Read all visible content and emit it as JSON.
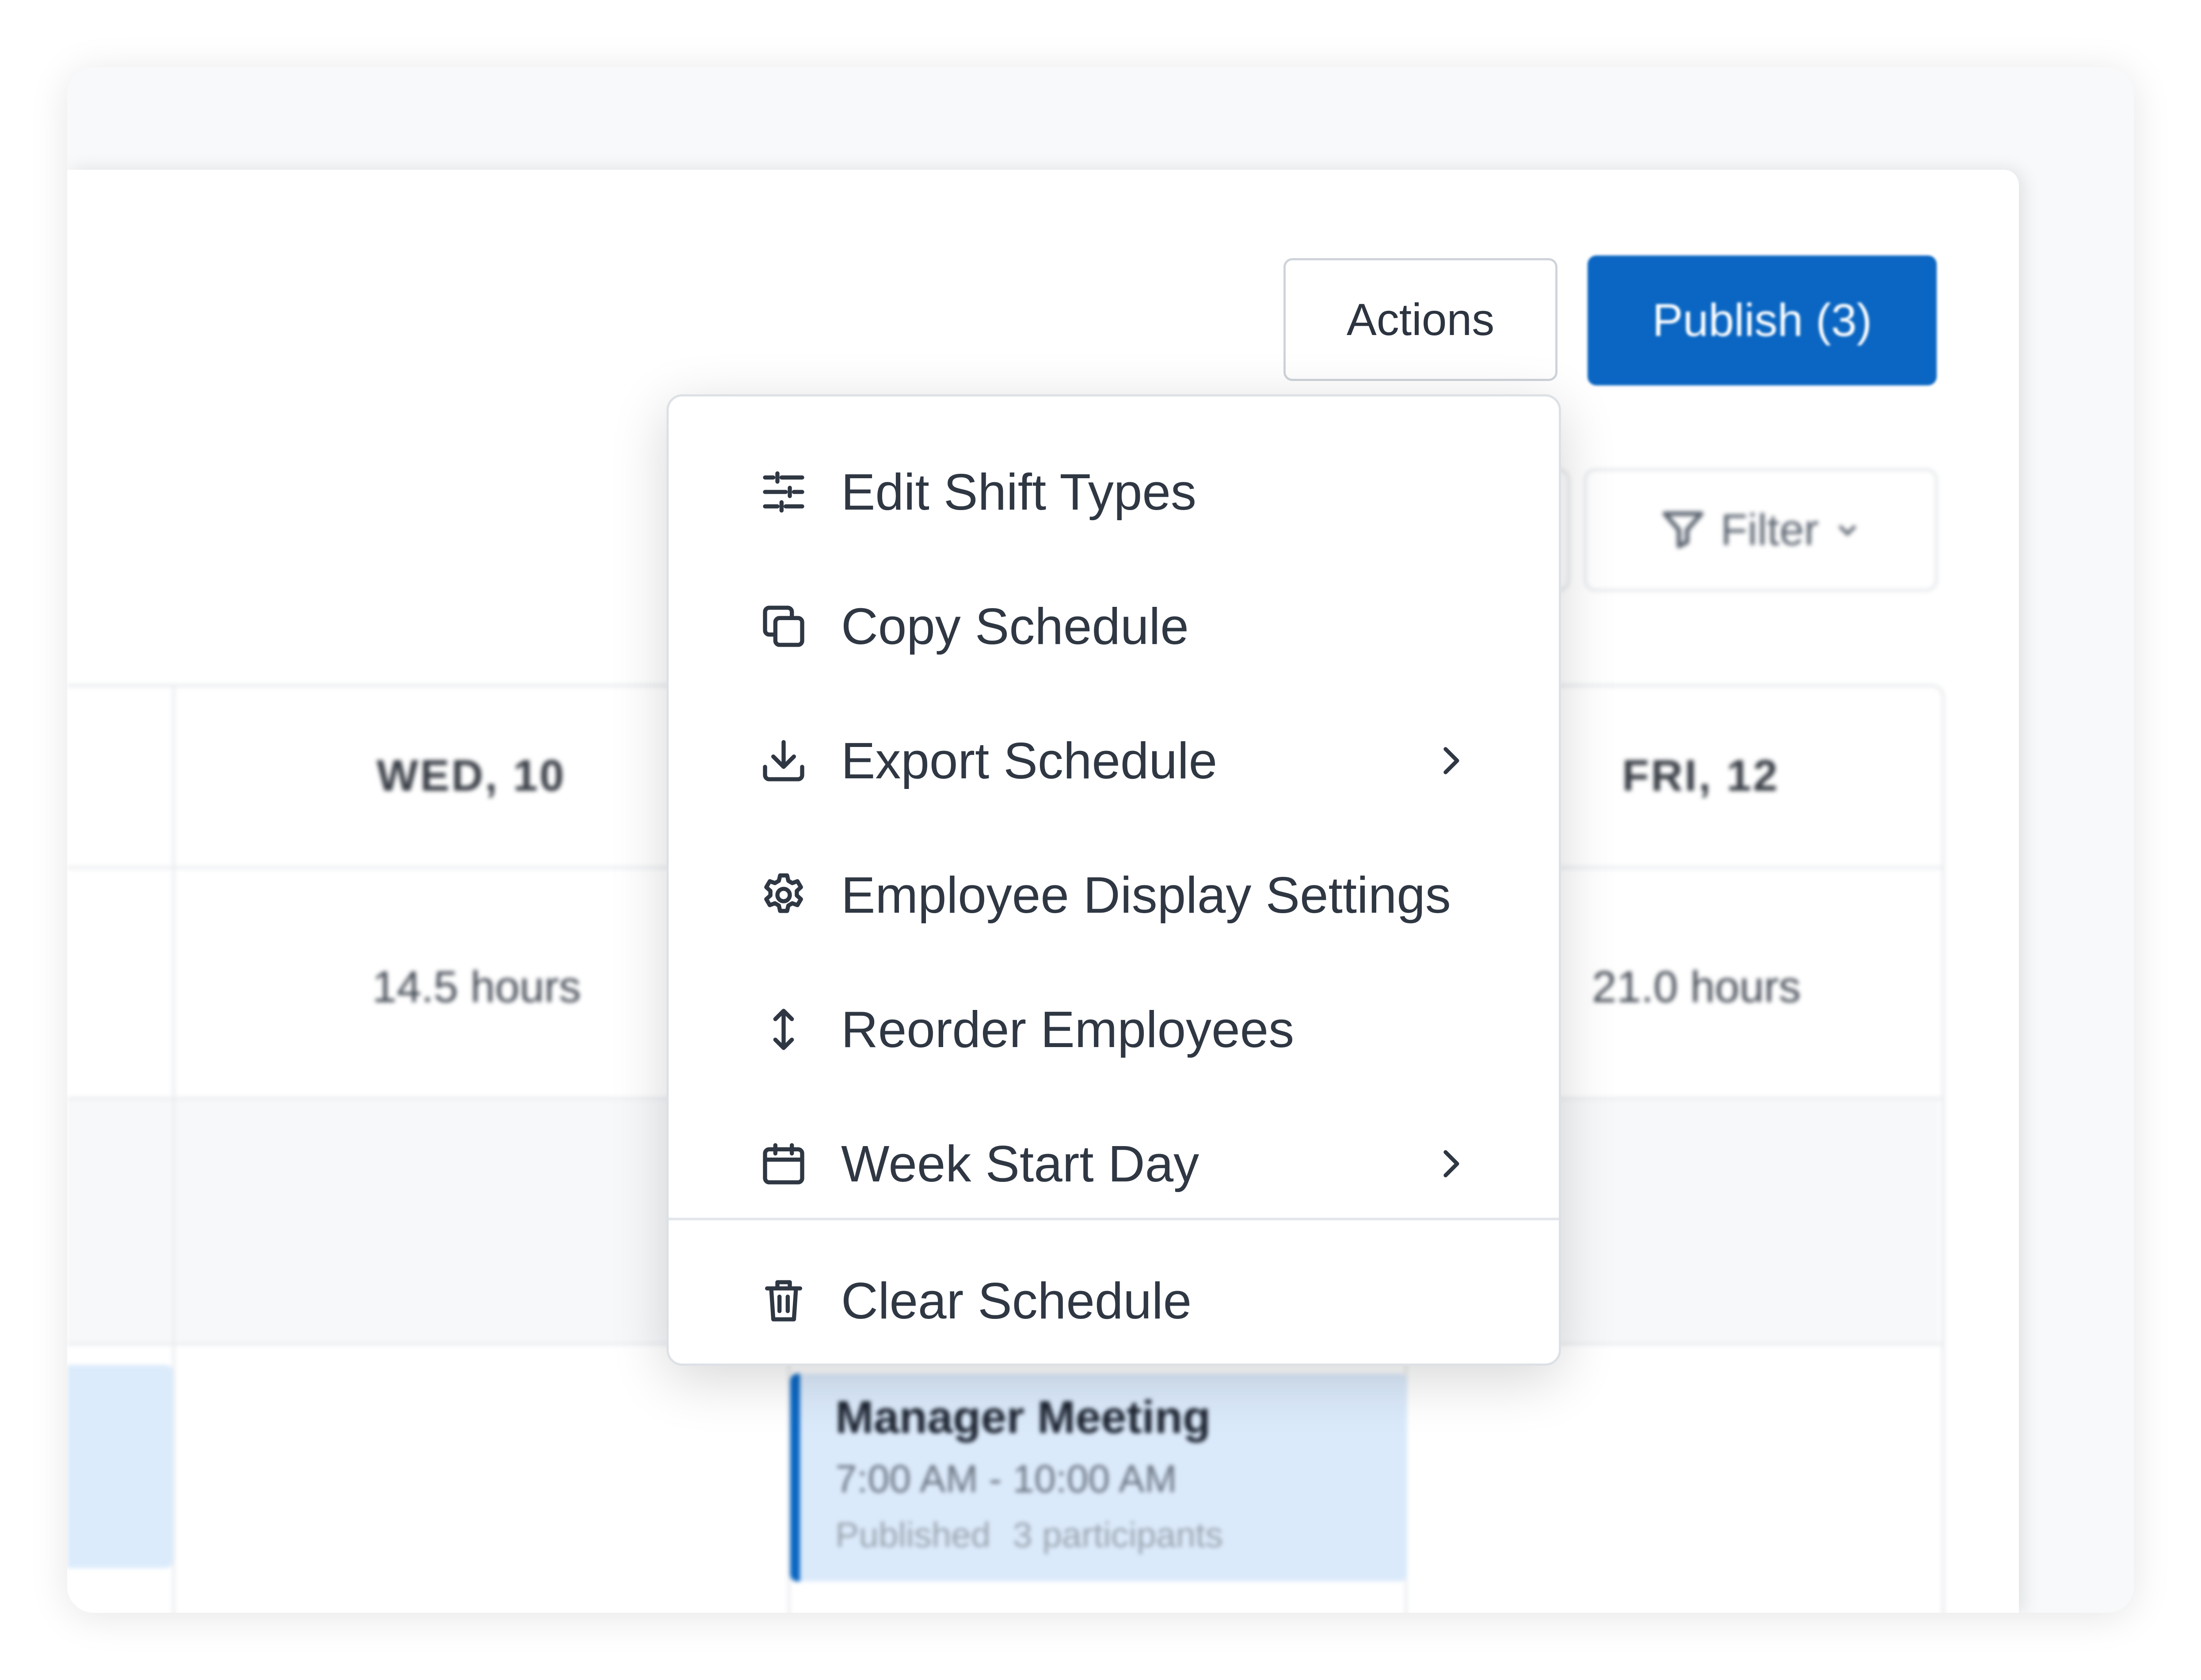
{
  "header": {
    "actions_label": "Actions",
    "publish_label": "Publish (3)",
    "filter_label": "Filter"
  },
  "grid": {
    "days": [
      {
        "label": "WED, 10",
        "hours": "14.5 hours"
      },
      {
        "label": "FRI, 12",
        "hours": "21.0 hours"
      }
    ],
    "shift": {
      "title": "Manager Meeting",
      "time": "7:00 AM - 10:00 AM",
      "status": "Published",
      "participants": "3 participants"
    }
  },
  "menu": {
    "items": [
      {
        "label": "Edit Shift Types",
        "icon": "sliders-icon",
        "submenu": false
      },
      {
        "label": "Copy Schedule",
        "icon": "copy-icon",
        "submenu": false
      },
      {
        "label": "Export Schedule",
        "icon": "download-icon",
        "submenu": true
      },
      {
        "label": "Employee Display Settings",
        "icon": "gear-icon",
        "submenu": false
      },
      {
        "label": "Reorder Employees",
        "icon": "vertical-arrows-icon",
        "submenu": false
      },
      {
        "label": "Week Start Day",
        "icon": "calendar-icon",
        "submenu": true
      },
      {
        "label": "Clear Schedule",
        "icon": "trash-icon",
        "submenu": false
      }
    ]
  },
  "colors": {
    "primary": "#0a66c2",
    "text": "#2f3743",
    "shift_bg": "#dbeafb"
  }
}
